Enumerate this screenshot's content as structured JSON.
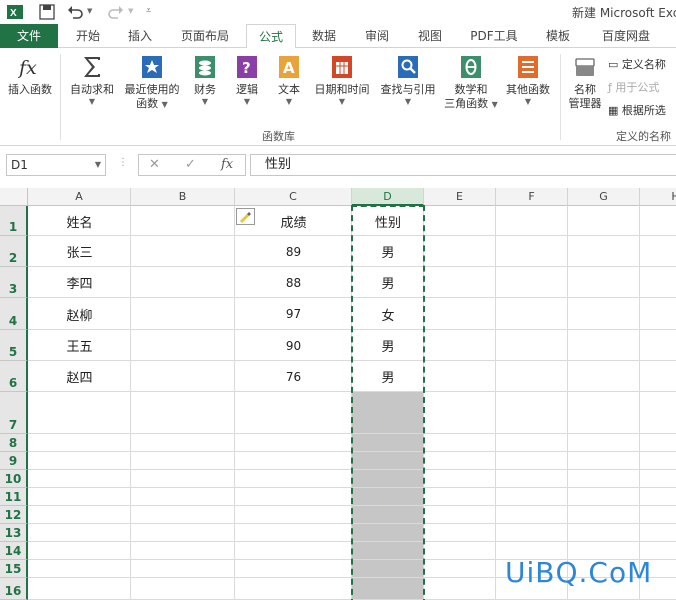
{
  "title": "新建 Microsoft Exc",
  "tabs": {
    "file": "文件",
    "home": "开始",
    "insert": "插入",
    "layout": "页面布局",
    "formulas": "公式",
    "data": "数据",
    "review": "审阅",
    "view": "视图",
    "pdf": "PDF工具",
    "template": "模板",
    "baidu": "百度网盘"
  },
  "ribbon": {
    "insert_function": "插入函数",
    "autosum": "自动求和",
    "recent_line1": "最近使用的",
    "recent_line2": "函数",
    "financial": "财务",
    "logical": "逻辑",
    "text": "文本",
    "datetime": "日期和时间",
    "lookup": "查找与引用",
    "math_line1": "数学和",
    "math_line2": "三角函数",
    "other": "其他函数",
    "name_mgr_line1": "名称",
    "name_mgr_line2": "管理器",
    "define_name": "定义名称",
    "use_in_formula": "用于公式",
    "create_from_sel": "根据所选",
    "group_function_library": "函数库",
    "group_defined_names": "定义的名称"
  },
  "formula_bar": {
    "name_box": "D1",
    "cancel": "✕",
    "enter": "✓",
    "fx": "fx",
    "content": "性别"
  },
  "columns": [
    "A",
    "B",
    "C",
    "D",
    "E",
    "F",
    "G",
    "H"
  ],
  "rows": [
    "1",
    "2",
    "3",
    "4",
    "5",
    "6",
    "7",
    "8",
    "9",
    "10",
    "11",
    "12",
    "13",
    "14",
    "15",
    "16"
  ],
  "cells": {
    "A1": "姓名",
    "C1": "成绩",
    "D1": "性别",
    "A2": "张三",
    "C2": "89",
    "D2": "男",
    "A3": "李四",
    "C3": "88",
    "D3": "男",
    "A4": "赵柳",
    "C4": "97",
    "D4": "女",
    "A5": "王五",
    "C5": "90",
    "D5": "男",
    "A6": "赵四",
    "C6": "76",
    "D6": "男"
  },
  "watermark": "UiBQ.CoM",
  "colors": {
    "accent": "#217346",
    "selection_fill": "#c6c6c6",
    "watermark": "#2e86d8"
  }
}
